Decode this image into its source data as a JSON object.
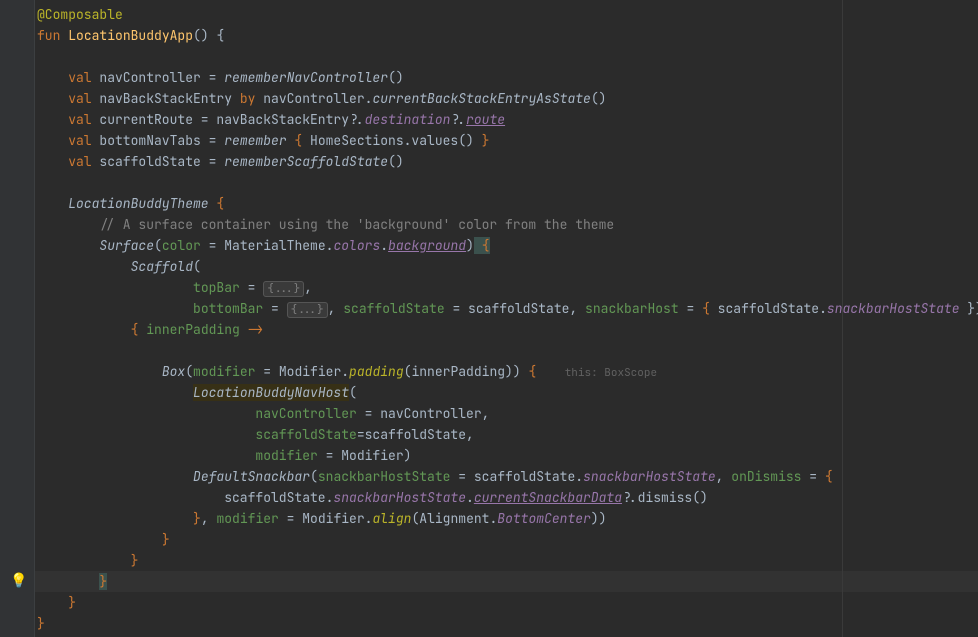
{
  "code": {
    "l1_annotation": "@Composable",
    "l2_fun": "fun",
    "l2_name": "LocationBuddyApp",
    "l2_parens": "()",
    "l2_brace": " {",
    "l4_val": "val",
    "l4_var": " navController = ",
    "l4_fun": "rememberNavController",
    "l4_end": "()",
    "l5_val": "val",
    "l5_var": " navBackStackEntry ",
    "l5_by": "by",
    "l5_mid": " navController.",
    "l5_fun": "currentBackStackEntryAsState",
    "l5_end": "()",
    "l6_val": "val",
    "l6_var": " currentRoute = navBackStackEntry?.",
    "l6_dest": "destination",
    "l6_q": "?.",
    "l6_route": "route",
    "l7_val": "val",
    "l7_var": " bottomNavTabs = ",
    "l7_fun": "remember",
    "l7_brace1": " {",
    "l7_mid": " HomeSections.values() ",
    "l7_brace2": "}",
    "l8_val": "val",
    "l8_var": " scaffoldState = ",
    "l8_fun": "rememberScaffoldState",
    "l8_end": "()",
    "l10_theme": "LocationBuddyTheme",
    "l10_brace": " {",
    "l11_comment": "// A surface container using the 'background' color from the theme",
    "l12_surf": "Surface",
    "l12_open": "(",
    "l12_color": "color",
    "l12_eq": " = ",
    "l12_mt": "MaterialTheme.",
    "l12_colors": "colors",
    "l12_dot": ".",
    "l12_bg": "background",
    "l12_close": ")",
    "l12_brace": " {",
    "l13_scaf": "Scaffold",
    "l13_open": "(",
    "l14_topbar": "topBar",
    "l14_eq": " = ",
    "l14_fold": "{...}",
    "l14_comma": ",",
    "l15_botbar": "bottomBar",
    "l15_eq": " = ",
    "l15_fold": "{...}",
    "l15_comma": ", ",
    "l15_ss": "scaffoldState",
    "l15_sseq": " = scaffoldState, ",
    "l15_sh": "snackbarHost",
    "l15_sheq": " = ",
    "l15_br1": "{",
    "l15_ssdot": " scaffoldState.",
    "l15_shs": "snackbarHostState",
    "l15_end": " })",
    "l16_open": "{",
    "l16_param": " innerPadding",
    "l16_arrow": " ->",
    "l18_box": "Box",
    "l18_open": "(",
    "l18_mod": "modifier",
    "l18_eq": " = ",
    "l18_modifier": "Modifier.",
    "l18_pad": "padding",
    "l18_inner": "(innerPadding))",
    "l18_brace": " {",
    "l18_hint": "this: BoxScope",
    "l19_nav": "LocationBuddyNavHost",
    "l19_open": "(",
    "l20_nc": "navController",
    "l20_eq": " = navController,",
    "l21_ss": "scaffoldState",
    "l21_eq": "=scaffoldState,",
    "l22_mod": "modifier",
    "l22_eq": " = Modifier)",
    "l23_ds": "DefaultSnackbar",
    "l23_open": "(",
    "l23_shs": "snackbarHostState",
    "l23_eq": " = ",
    "l23_ss": "scaffoldState.",
    "l23_shsprop": "snackbarHostState",
    "l23_comma": ", ",
    "l23_ond": "onDismiss",
    "l23_ondeq": " = ",
    "l23_brace": "{",
    "l24_ss": "scaffoldState.",
    "l24_shs": "snackbarHostState",
    "l24_dot": ".",
    "l24_csd": "currentSnackbarData",
    "l24_end": "?.dismiss()",
    "l25_close": "}",
    "l25_comma": ", ",
    "l25_mod": "modifier",
    "l25_eq": " = Modifier.",
    "l25_align": "align",
    "l25_open": "(Alignment.",
    "l25_bc": "BottomCenter",
    "l25_end": "))",
    "l26_close": "}",
    "l27_close": "}",
    "l28_close": "}",
    "l29_close": "}",
    "l30_close": "}"
  },
  "bulb": "💡"
}
